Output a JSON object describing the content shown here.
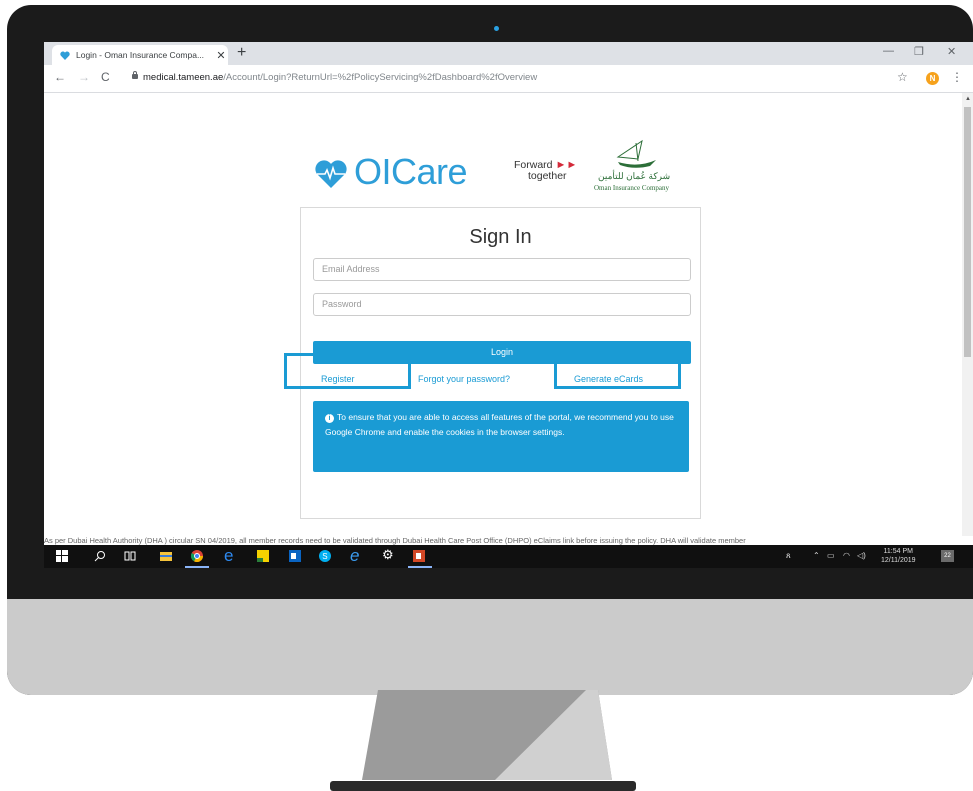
{
  "browser": {
    "tab_title": "Login - Oman Insurance Compa...",
    "tab_close": "✕",
    "new_tab": "+",
    "url_host": "medical.tameen.ae",
    "url_path": "/Account/Login?ReturnUrl=%2fPolicyServicing%2fDashboard%2fOverview",
    "profile_initial": "N",
    "window_controls": [
      "—",
      "❐",
      "✕"
    ]
  },
  "branding": {
    "product": "OICare",
    "tagline_1": "Forward",
    "tagline_2": "together",
    "company_ar": "شركة عُمان للتأمين",
    "company_en": "Oman Insurance Company"
  },
  "signin": {
    "title": "Sign In",
    "email_placeholder": "Email Address",
    "password_placeholder": "Password",
    "login_label": "Login",
    "register_label": "Register",
    "forgot_label": "Forgot your password?",
    "ecards_label": "Generate eCards",
    "notice": "To ensure that you are able to access all features of the portal, we recommend you to use Google Chrome and enable the cookies in the browser settings."
  },
  "footer": {
    "text": "As per Dubai Health Authority (DHA ) circular SN 04/2019, all member records need to be validated through Dubai Health Care Post Office (DHPO) eClaims link before issuing the policy. DHA will validate member"
  },
  "taskbar": {
    "time": "11:54 PM",
    "date": "12/11/2019",
    "notifications": "22"
  },
  "colors": {
    "accent": "#1a9bd4",
    "brand_blue": "#2e9ed8",
    "brand_red": "#d42a3a",
    "brand_green": "#2c6e38"
  }
}
